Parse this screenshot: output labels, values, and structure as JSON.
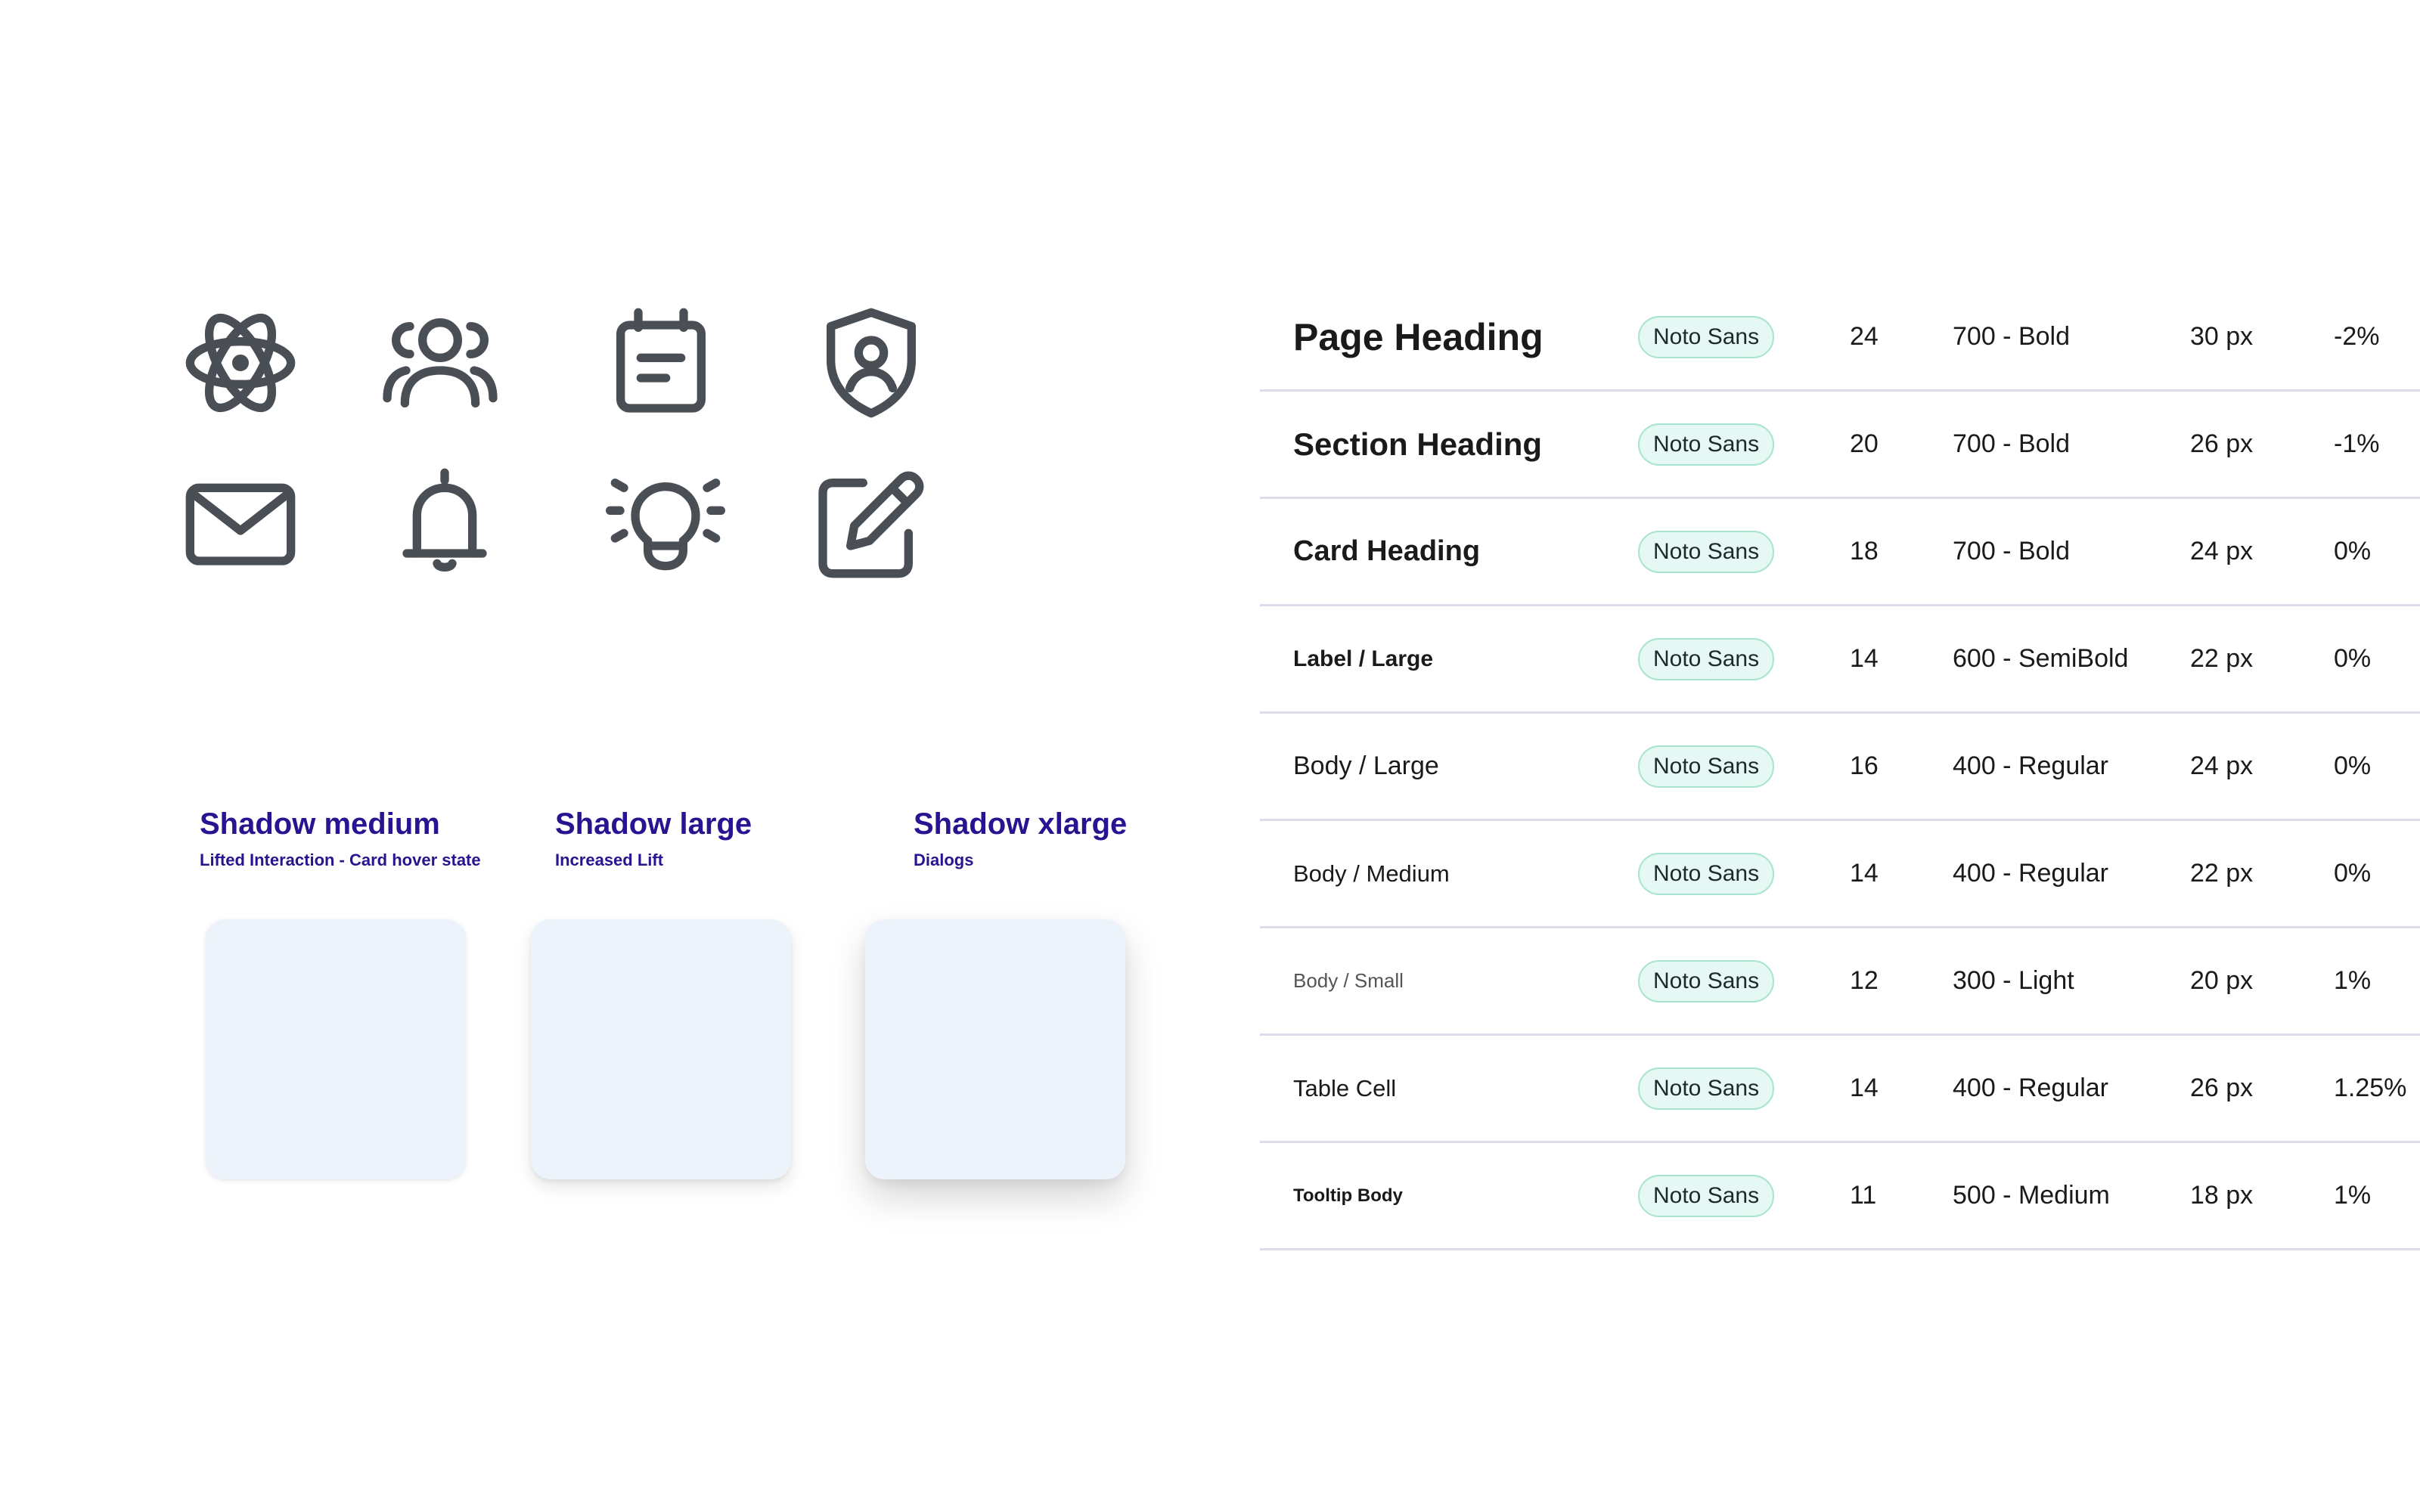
{
  "icons": [
    {
      "name": "atom-icon"
    },
    {
      "name": "users-icon"
    },
    {
      "name": "calendar-icon"
    },
    {
      "name": "shield-user-icon"
    },
    {
      "name": "mail-icon"
    },
    {
      "name": "bell-icon"
    },
    {
      "name": "lightbulb-icon"
    },
    {
      "name": "edit-icon"
    }
  ],
  "icon_color": "#4a4f55",
  "shadows": [
    {
      "title": "Shadow medium",
      "subtitle": "Lifted Interaction - Card hover state"
    },
    {
      "title": "Shadow large",
      "subtitle": "Increased Lift"
    },
    {
      "title": "Shadow xlarge",
      "subtitle": "Dialogs"
    }
  ],
  "shadow_title_color": "#2a1390",
  "card_color": "#edf3fa",
  "typography": {
    "rows": [
      {
        "name": "Page Heading",
        "font": "Noto Sans",
        "size": "24",
        "weight": "700 - Bold",
        "line_height": "30 px",
        "letter_spacing": "-2%"
      },
      {
        "name": "Section Heading",
        "font": "Noto Sans",
        "size": "20",
        "weight": "700 - Bold",
        "line_height": "26 px",
        "letter_spacing": "-1%"
      },
      {
        "name": "Card Heading",
        "font": "Noto Sans",
        "size": "18",
        "weight": "700 - Bold",
        "line_height": "24 px",
        "letter_spacing": "0%"
      },
      {
        "name": "Label / Large",
        "font": "Noto Sans",
        "size": "14",
        "weight": "600 - SemiBold",
        "line_height": "22 px",
        "letter_spacing": "0%"
      },
      {
        "name": "Body / Large",
        "font": "Noto Sans",
        "size": "16",
        "weight": "400 - Regular",
        "line_height": "24 px",
        "letter_spacing": "0%"
      },
      {
        "name": "Body / Medium",
        "font": "Noto Sans",
        "size": "14",
        "weight": "400 - Regular",
        "line_height": "22 px",
        "letter_spacing": "0%"
      },
      {
        "name": "Body / Small",
        "font": "Noto Sans",
        "size": "12",
        "weight": "300 - Light",
        "line_height": "20 px",
        "letter_spacing": "1%"
      },
      {
        "name": "Table Cell",
        "font": "Noto Sans",
        "size": "14",
        "weight": "400 - Regular",
        "line_height": "26 px",
        "letter_spacing": "1.25%"
      },
      {
        "name": "Tooltip Body",
        "font": "Noto Sans",
        "size": "11",
        "weight": "500 - Medium",
        "line_height": "18 px",
        "letter_spacing": "1%"
      }
    ]
  },
  "pill_color": "#e6f8f3",
  "divider_color": "#dcdcea"
}
